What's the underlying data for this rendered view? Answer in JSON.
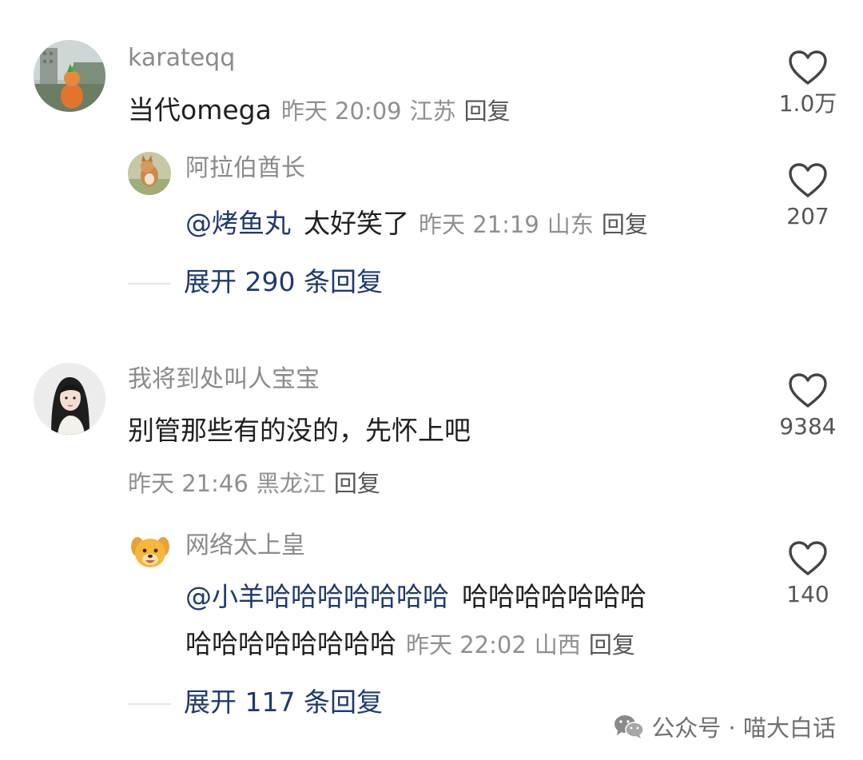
{
  "comments": [
    {
      "username": "karateqq",
      "text": "当代omega",
      "time": "昨天 20:09",
      "location": "江苏",
      "reply_label": "回复",
      "likes": "1.0万",
      "replies": [
        {
          "username": "阿拉伯酋长",
          "mention": "@烤鱼丸",
          "text": "太好笑了",
          "time": "昨天 21:19",
          "location": "山东",
          "reply_label": "回复",
          "likes": "207"
        }
      ],
      "expand_label": "展开 290 条回复"
    },
    {
      "username": "我将到处叫人宝宝",
      "text": "别管那些有的没的，先怀上吧",
      "time": "昨天 21:46",
      "location": "黑龙江",
      "reply_label": "回复",
      "likes": "9384",
      "replies": [
        {
          "username": "网络太上皇",
          "mention": "@小羊哈哈哈哈哈哈哈",
          "text_line1": "哈哈哈哈哈哈哈",
          "text_line2": "哈哈哈哈哈哈哈哈",
          "time": "昨天 22:02",
          "location": "山西",
          "reply_label": "回复",
          "likes": "140"
        }
      ],
      "expand_label": "展开 117 条回复"
    }
  ],
  "watermark": {
    "text": "公众号 · 喵大白话",
    "icon": "wechat-icon"
  },
  "icons": {
    "like": "heart-outline-icon"
  }
}
